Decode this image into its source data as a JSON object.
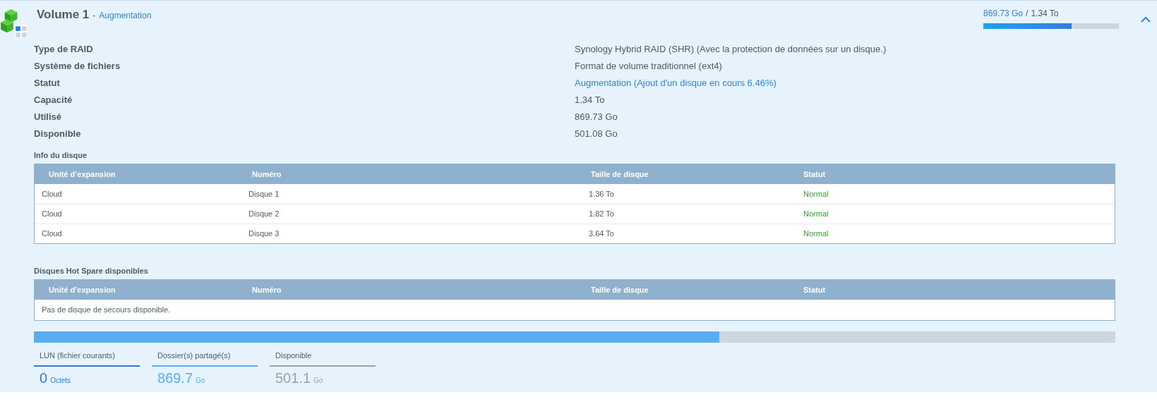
{
  "volume": {
    "title": "Volume 1",
    "separator": "-",
    "status_link": "Augmentation",
    "used": "869.73 Go",
    "usage_separator": "/",
    "total": "1.34 To",
    "level": 0.649,
    "expanded": true
  },
  "properties": [
    {
      "label": "Type de RAID",
      "value": "Synology Hybrid RAID (SHR) (Avec la protection de données sur un disque.)",
      "kind": "plain"
    },
    {
      "label": "Système de fichiers",
      "value": "Format de volume traditionnel (ext4)",
      "kind": "plain"
    },
    {
      "label": "Statut",
      "value": "Augmentation (Ajout d'un disque en cours 6.46%)",
      "kind": "link"
    },
    {
      "label": "Capacité",
      "value": "1.34 To",
      "kind": "plain"
    },
    {
      "label": "Utilisé",
      "value": "869.73 Go",
      "kind": "plain"
    },
    {
      "label": "Disponible",
      "value": "501.08 Go",
      "kind": "plain"
    }
  ],
  "disk_info": {
    "title": "Info du disque",
    "columns": [
      "Unité d’expansion",
      "Numéro",
      "Taille de disque",
      "Statut"
    ],
    "rows": [
      [
        "Cloud",
        "Disque 1",
        "1.36 To",
        "Normal"
      ],
      [
        "Cloud",
        "Disque 2",
        "1.82 To",
        "Normal"
      ],
      [
        "Cloud",
        "Disque 3",
        "3.64 To",
        "Normal"
      ]
    ]
  },
  "hot_spare": {
    "title": "Disques Hot Spare disponibles",
    "columns": [
      "Unité d’expansion",
      "Numéro",
      "Taille de disque",
      "Statut"
    ],
    "empty_message": "Pas de disque de secours disponible."
  },
  "usage_bar": [
    {
      "label": "LUN (fichier courants)",
      "value": "0",
      "unit": "Octets",
      "color": "#2f7bd6"
    },
    {
      "label": "Dossier(s) partagé(s)",
      "value": "869.7",
      "unit": "Go",
      "level": 0.634,
      "color": "#5aaef0"
    },
    {
      "label": "Disponible",
      "value": "501.1",
      "unit": "Go",
      "color": "#9aa3ad"
    }
  ]
}
